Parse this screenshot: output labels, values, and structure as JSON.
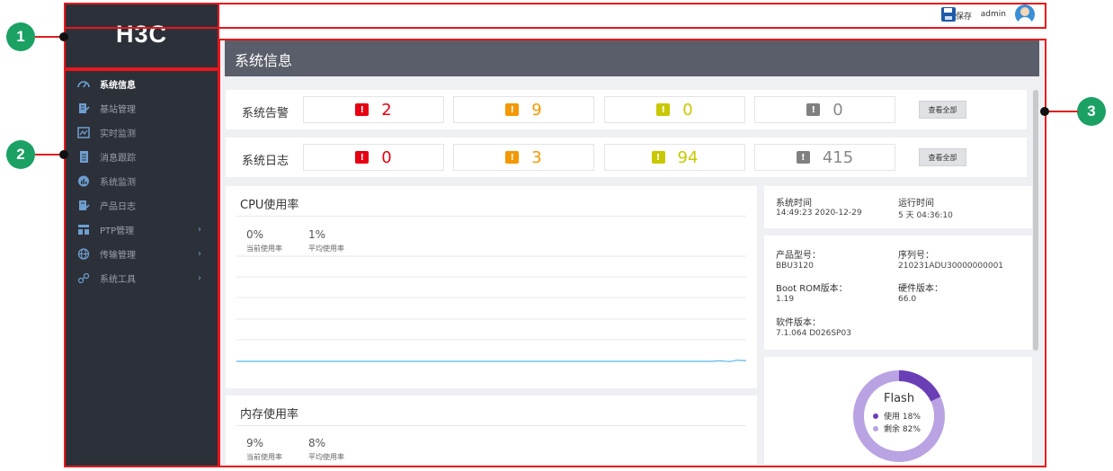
{
  "brand": {
    "logo": "H3C"
  },
  "header": {
    "save_label": "保存",
    "user": "admin"
  },
  "sidebar": {
    "items": [
      {
        "label": "系统信息",
        "icon": "dashboard-icon",
        "active": true
      },
      {
        "label": "基站管理",
        "icon": "edit-document-icon"
      },
      {
        "label": "实时监测",
        "icon": "monitor-chart-icon"
      },
      {
        "label": "消息跟踪",
        "icon": "message-document-icon"
      },
      {
        "label": "系统监测",
        "icon": "pie-chart-icon"
      },
      {
        "label": "产品日志",
        "icon": "log-document-icon"
      },
      {
        "label": "PTP管理",
        "icon": "ptp-table-icon",
        "expandable": true
      },
      {
        "label": "传输管理",
        "icon": "globe-icon",
        "expandable": true
      },
      {
        "label": "系统工具",
        "icon": "tools-link-icon",
        "expandable": true
      }
    ]
  },
  "page": {
    "title": "系统信息"
  },
  "alarms": {
    "label": "系统告警",
    "counts": [
      "2",
      "9",
      "0",
      "0"
    ],
    "view_all": "查看全部"
  },
  "logs": {
    "label": "系统日志",
    "counts": [
      "0",
      "3",
      "94",
      "415"
    ],
    "view_all": "查看全部"
  },
  "severity_colors": [
    "#e60012",
    "#f39800",
    "#c8c800",
    "#808080"
  ],
  "cpu": {
    "title": "CPU使用率",
    "current": "0%",
    "current_label": "当前使用率",
    "average": "1%",
    "average_label": "平均使用率"
  },
  "memory": {
    "title": "内存使用率",
    "current": "9%",
    "current_label": "当前使用率",
    "average": "8%",
    "average_label": "平均使用率"
  },
  "system_time": {
    "time_label": "系统时间",
    "time_value": "14:49:23  2020-12-29",
    "uptime_label": "运行时间",
    "uptime_value": "5 天  04:36:10"
  },
  "product": {
    "model_label": "产品型号：",
    "model_value": "BBU3120",
    "serial_label": "序列号：",
    "serial_value": "210231ADU30000000001",
    "bootrom_label": "Boot ROM版本：",
    "bootrom_value": "1.19",
    "hardware_label": "硬件版本：",
    "hardware_value": "66.0",
    "software_label": "软件版本：",
    "software_value": "7.1.064 D026SP03"
  },
  "flash": {
    "title": "Flash",
    "used_label": "使用 18%",
    "free_label": "剩余 82%",
    "used_fraction": 0.18,
    "used_color": "#6a3fb5",
    "free_color": "#b9a3e3"
  },
  "callouts": [
    "1",
    "2",
    "3"
  ]
}
